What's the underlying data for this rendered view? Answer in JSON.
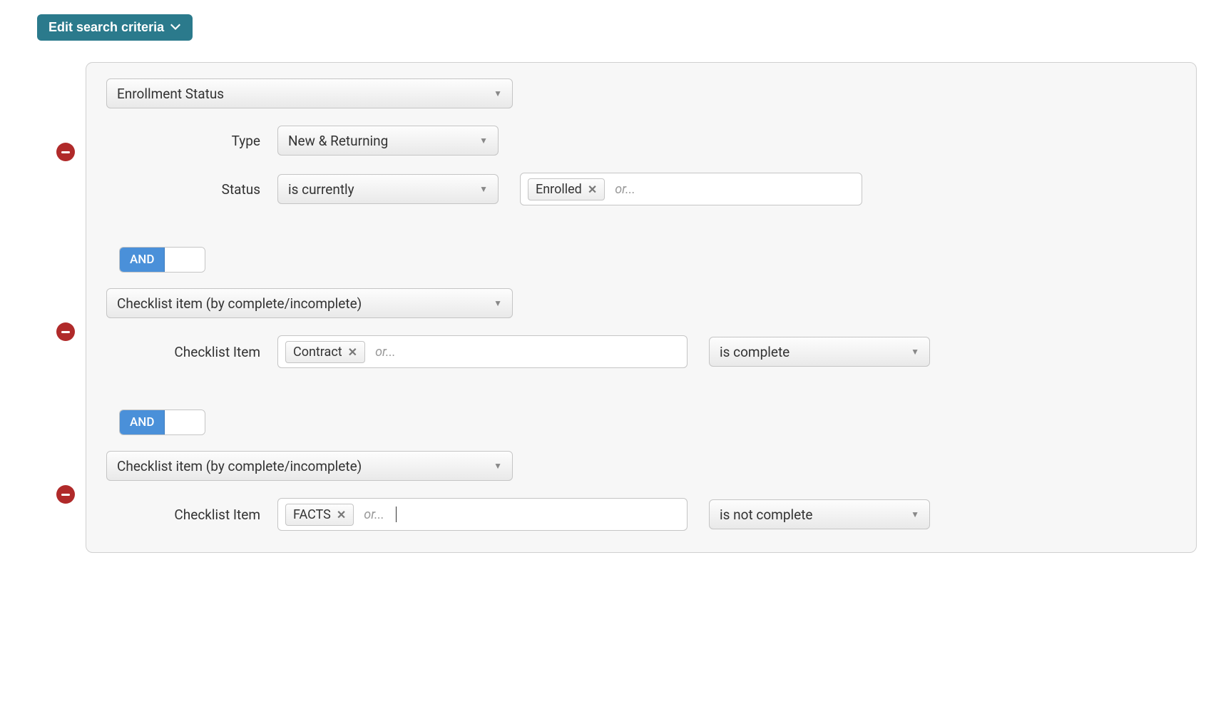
{
  "header": {
    "edit_criteria_label": "Edit search criteria"
  },
  "labels": {
    "type": "Type",
    "status": "Status",
    "checklist_item": "Checklist Item",
    "or_placeholder": "or..."
  },
  "operators": {
    "and": "AND"
  },
  "criteria": [
    {
      "category": "Enrollment Status",
      "fields": {
        "type_value": "New & Returning",
        "status_operator": "is currently",
        "status_tags": [
          "Enrolled"
        ]
      }
    },
    {
      "category": "Checklist item (by complete/incomplete)",
      "fields": {
        "checklist_tags": [
          "Contract"
        ],
        "checklist_operator": "is complete"
      }
    },
    {
      "category": "Checklist item (by complete/incomplete)",
      "fields": {
        "checklist_tags": [
          "FACTS"
        ],
        "checklist_operator": "is not complete"
      }
    }
  ]
}
